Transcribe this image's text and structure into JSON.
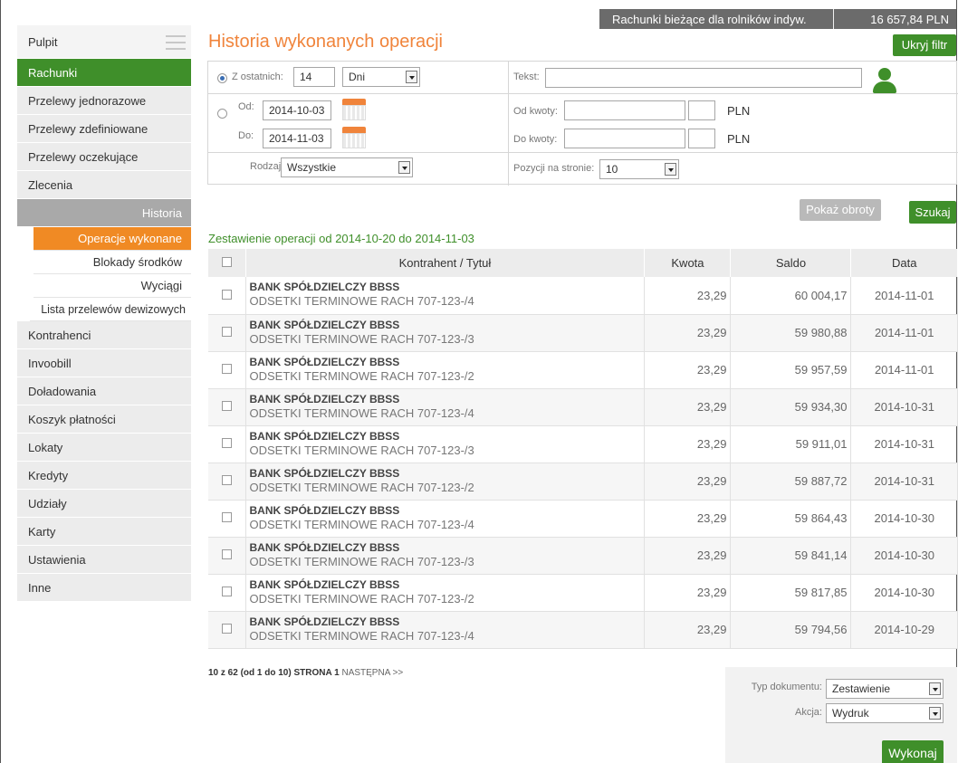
{
  "account": {
    "name": "Rachunki bieżące dla rolników indyw.",
    "balance": "16 657,84 PLN"
  },
  "sidebar": {
    "items": [
      {
        "label": "Pulpit"
      },
      {
        "label": "Rachunki"
      },
      {
        "label": "Przelewy jednorazowe"
      },
      {
        "label": "Przelewy zdefiniowane"
      },
      {
        "label": "Przelewy oczekujące"
      },
      {
        "label": "Zlecenia"
      },
      {
        "label": "Historia"
      }
    ],
    "history_sub": [
      {
        "label": "Operacje wykonane"
      },
      {
        "label": "Blokady środków"
      },
      {
        "label": "Wyciągi"
      },
      {
        "label": "Lista przelewów dewizowych"
      }
    ],
    "items_after": [
      {
        "label": "Kontrahenci"
      },
      {
        "label": "Invoobill"
      },
      {
        "label": "Doładowania"
      },
      {
        "label": "Koszyk płatności"
      },
      {
        "label": "Lokaty"
      },
      {
        "label": "Kredyty"
      },
      {
        "label": "Udziały"
      },
      {
        "label": "Karty"
      },
      {
        "label": "Ustawienia"
      },
      {
        "label": "Inne"
      }
    ]
  },
  "header": {
    "title": "Historia wykonanych operacji",
    "hide_filter": "Ukryj filtr"
  },
  "filter": {
    "last_label": "Z ostatnich:",
    "last_value": "14",
    "unit": "Dni",
    "from_label": "Od:",
    "from_value": "2014-10-03",
    "to_label": "Do:",
    "to_value": "2014-11-03",
    "type_label": "Rodzaj:",
    "type_value": "Wszystkie",
    "text_label": "Tekst:",
    "amount_from_label": "Od kwoty:",
    "amount_to_label": "Do kwoty:",
    "currency": "PLN",
    "per_page_label": "Pozycji na stronie:",
    "per_page_value": "10"
  },
  "actions": {
    "show_turnover": "Pokaż obroty",
    "search": "Szukaj"
  },
  "summary": "Zestawienie operacji od 2014-10-20 do 2014-11-03",
  "table": {
    "headers": {
      "contractor": "Kontrahent /  Tytuł",
      "amount": "Kwota",
      "balance": "Saldo",
      "date": "Data"
    },
    "rows": [
      {
        "name": "BANK SPÓŁDZIELCZY BBSS",
        "title": "ODSETKI TERMINOWE RACH 707-123-/4",
        "amount": "23,29",
        "balance": "60 004,17",
        "date": "2014-11-01"
      },
      {
        "name": "BANK SPÓŁDZIELCZY BBSS",
        "title": "ODSETKI TERMINOWE RACH 707-123-/3",
        "amount": "23,29",
        "balance": "59 980,88",
        "date": "2014-11-01"
      },
      {
        "name": "BANK SPÓŁDZIELCZY BBSS",
        "title": "ODSETKI TERMINOWE RACH 707-123-/2",
        "amount": "23,29",
        "balance": "59 957,59",
        "date": "2014-11-01"
      },
      {
        "name": "BANK SPÓŁDZIELCZY BBSS",
        "title": "ODSETKI TERMINOWE RACH 707-123-/4",
        "amount": "23,29",
        "balance": "59 934,30",
        "date": "2014-10-31"
      },
      {
        "name": "BANK SPÓŁDZIELCZY BBSS",
        "title": "ODSETKI TERMINOWE RACH 707-123-/3",
        "amount": "23,29",
        "balance": "59 911,01",
        "date": "2014-10-31"
      },
      {
        "name": "BANK SPÓŁDZIELCZY BBSS",
        "title": "ODSETKI TERMINOWE RACH 707-123-/2",
        "amount": "23,29",
        "balance": "59 887,72",
        "date": "2014-10-31"
      },
      {
        "name": "BANK SPÓŁDZIELCZY BBSS",
        "title": "ODSETKI TERMINOWE RACH 707-123-/4",
        "amount": "23,29",
        "balance": "59 864,43",
        "date": "2014-10-30"
      },
      {
        "name": "BANK SPÓŁDZIELCZY BBSS",
        "title": "ODSETKI TERMINOWE RACH 707-123-/3",
        "amount": "23,29",
        "balance": "59 841,14",
        "date": "2014-10-30"
      },
      {
        "name": "BANK SPÓŁDZIELCZY BBSS",
        "title": "ODSETKI TERMINOWE RACH 707-123-/2",
        "amount": "23,29",
        "balance": "59 817,85",
        "date": "2014-10-30"
      },
      {
        "name": "BANK SPÓŁDZIELCZY BBSS",
        "title": "ODSETKI TERMINOWE RACH 707-123-/4",
        "amount": "23,29",
        "balance": "59 794,56",
        "date": "2014-10-29"
      }
    ]
  },
  "pager": {
    "info": "10 z 62 (od 1 do 10)",
    "page": "STRONA 1",
    "next": "NASTĘPNA >>"
  },
  "document": {
    "type_label": "Typ dokumentu:",
    "type_value": "Zestawienie",
    "action_label": "Akcja:",
    "action_value": "Wydruk",
    "execute": "Wykonaj"
  },
  "colors": {
    "green": "#3f8f2a",
    "orange": "#f0843b",
    "gray_bar": "#6b6b6b"
  }
}
